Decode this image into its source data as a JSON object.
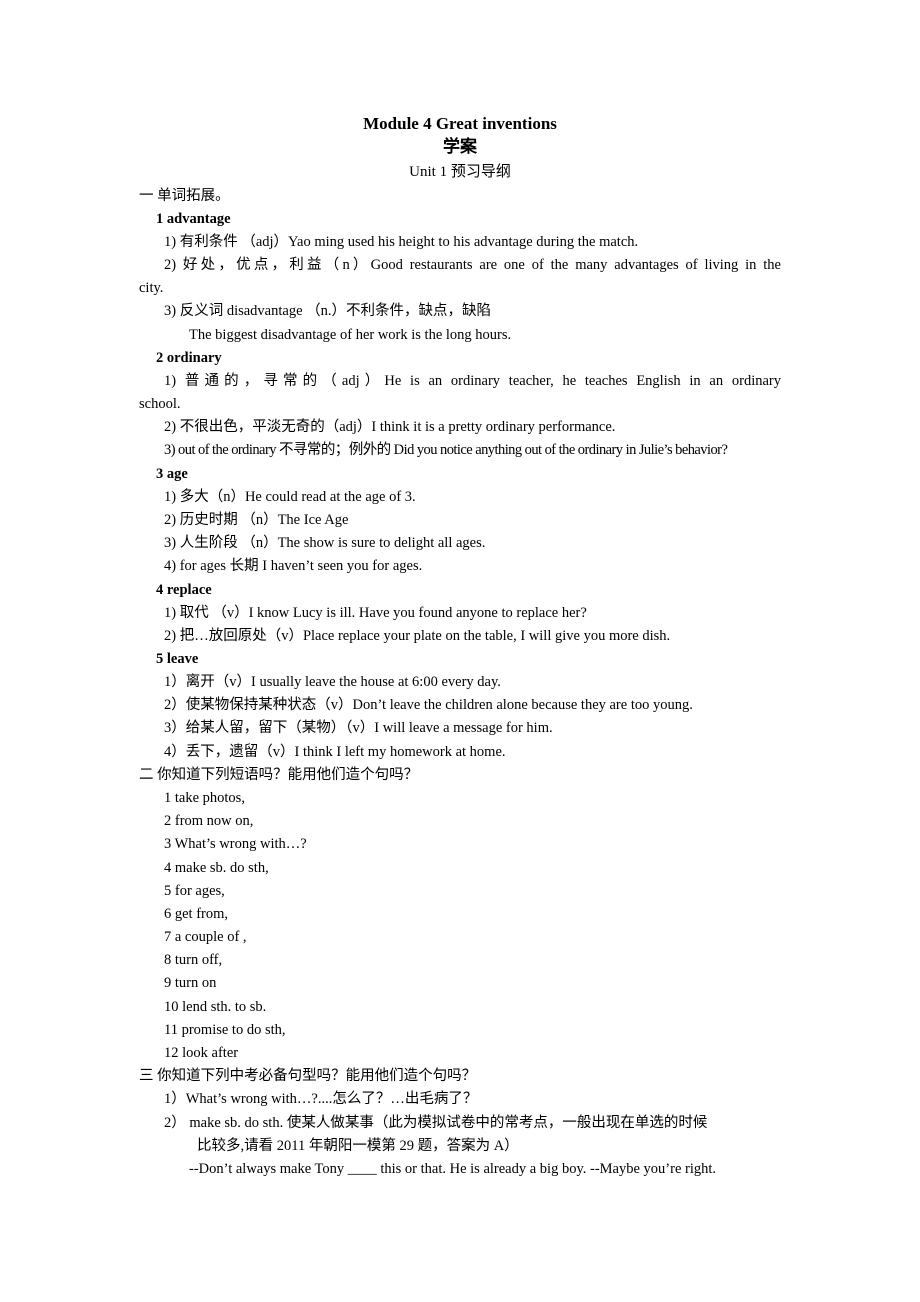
{
  "header": {
    "title": "Module 4 Great inventions",
    "subtitle": "学案",
    "unit": "Unit 1  预习导纲"
  },
  "section1": {
    "heading": "一  单词拓展。",
    "words": [
      {
        "title": "1 advantage",
        "lines": [
          "1)  有利条件  （adj）Yao ming used his height to his advantage during the match.",
          "2)  好处，优点，利益（n）Good restaurants are one of the many advantages of living in the",
          "city.",
          "3)  反义词  disadvantage  （n.）不利条件，缺点，缺陷",
          "The biggest disadvantage of her work is the long hours."
        ]
      },
      {
        "title": "2 ordinary",
        "lines": [
          "1)  普通的，寻常的（adj）He is an ordinary teacher, he teaches English in an ordinary",
          "school.",
          "2)  不很出色，平淡无奇的（adj）I think it is a pretty ordinary performance.",
          "3) out of the ordinary  不寻常的；例外的 Did you notice anything out of the ordinary in Julie’s behavior?"
        ]
      },
      {
        "title": "3 age",
        "lines": [
          "1)  多大（n）He could read at the age of 3.",
          "2)  历史时期  （n）The Ice Age",
          "3)  人生阶段  （n）The show is sure to delight all ages.",
          "4) for ages  长期    I haven’t seen you for ages."
        ]
      },
      {
        "title": "4 replace",
        "lines": [
          "1)  取代  （v）I know Lucy is ill. Have you found anyone to replace her?",
          "2)  把…放回原处（v）Place replace your plate on the table, I will give you more dish."
        ]
      },
      {
        "title": "5 leave",
        "lines": [
          "1）离开（v）I    usually leave the house at 6:00 every day.",
          "2）使某物保持某种状态（v）Don’t leave the children alone because they are too young.",
          "3）给某人留，留下（某物）（v）I will leave a message for him.",
          "4）丢下，遗留（v）I think I left my homework at home."
        ]
      }
    ]
  },
  "section2": {
    "heading": "二  你知道下列短语吗？能用他们造个句吗？",
    "phrases": [
      "1 take photos,",
      "2 from now on,",
      "3 What’s wrong with…?",
      "4 make sb. do sth,",
      "5 for ages,",
      "6 get from,",
      "7 a couple of ,",
      "8 turn off,",
      "9 turn on",
      "10 lend sth. to sb.",
      "11 promise to do sth,",
      "12 look after"
    ]
  },
  "section3": {
    "heading": "三  你知道下列中考必备句型吗？能用他们造个句吗？",
    "items": [
      "1）What’s wrong with…?....怎么了？…出毛病了？",
      "2）  make sb. do sth.  使某人做某事（此为模拟试卷中的常考点，一般出现在单选的时候",
      "比较多,请看 2011 年朝阳一模第 29 题，答案为 A）",
      "--Don’t always make Tony ____ this or that. He is already a big boy. --Maybe you’re right."
    ]
  }
}
